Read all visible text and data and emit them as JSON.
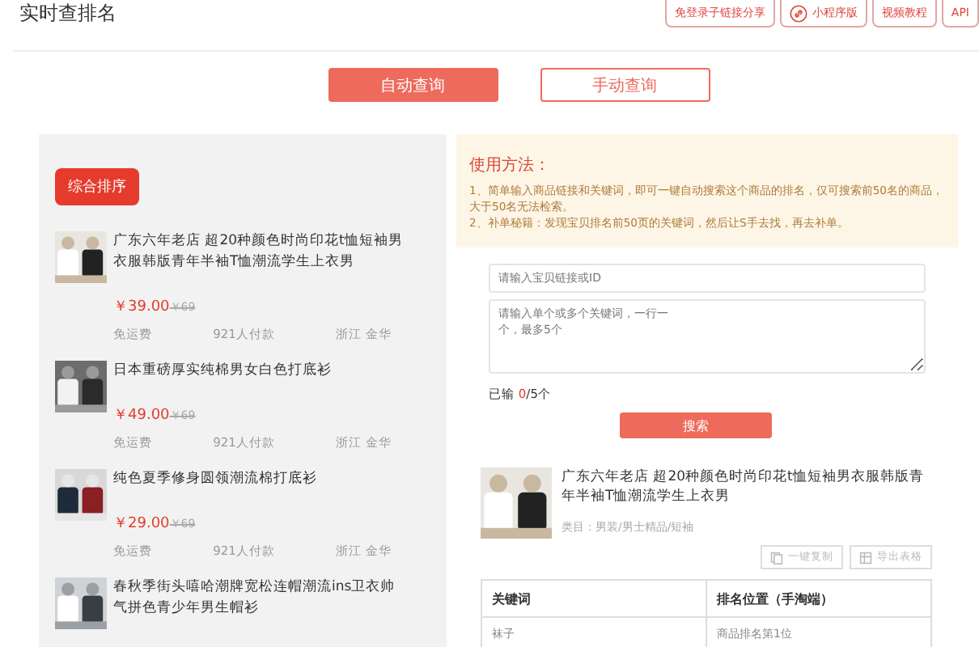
{
  "page_title": "实时查排名",
  "top_links": [
    {
      "label": "免登录子链接分享",
      "icon": false
    },
    {
      "label": "小程序版",
      "icon": true
    },
    {
      "label": "视频教程",
      "icon": false
    },
    {
      "label": "API",
      "icon": false
    }
  ],
  "tabs": [
    {
      "label": "自动查询",
      "selected": true
    },
    {
      "label": "手动查询",
      "selected": false
    }
  ],
  "sort_button": "综合排序",
  "products": [
    {
      "kind": "picture",
      "title": "广东六年老店 超20种颜色时尚印花t恤短袖男衣服韩版青年半袖T恤潮流学生上衣男",
      "price": "￥39.00",
      "old_price": "￥69",
      "shipping": "免运费",
      "sales": "921人付款",
      "location": "浙江 金华"
    },
    {
      "kind": "picture",
      "title": "日本重磅厚实纯棉男女白色打底衫",
      "price": "￥49.00",
      "old_price": "￥69",
      "shipping": "免运费",
      "sales": "921人付款",
      "location": "浙江 金华"
    },
    {
      "kind": "picture",
      "title": "纯色夏季修身圆领潮流棉打底衫",
      "price": "￥29.00",
      "old_price": "￥69",
      "shipping": "免运费",
      "sales": "921人付款",
      "location": "浙江 金华"
    },
    {
      "kind": "picture",
      "title": "春秋季街头嘻哈潮牌宽松连帽潮流ins卫衣帅气拼色青少年男生帽衫"
    }
  ],
  "notice": {
    "title": "使用方法：",
    "lines": [
      "1、简单输入商品链接和关键词，即可一键自动搜索这个商品的排名，仅可搜索前50名的商品，大于50名无法检索。",
      "2、补单秘籍：发现宝贝排名前50页的关键词，然后让S手去找，再去补单。"
    ]
  },
  "link_input": {
    "placeholder": "请输入宝贝链接或ID"
  },
  "keyword_input": {
    "placeholder": "请输入单个或多个关键词，一行一个，最多5个"
  },
  "counter": {
    "label": "已输",
    "count": "0",
    "limit": "/5个"
  },
  "search_button": "搜索",
  "result": {
    "title": "广东六年老店 超20种颜色时尚印花t恤短袖男衣服韩版青年半袖T恤潮流学生上衣男",
    "category": "类目：男装/男士精品/短袖"
  },
  "actions": [
    "一键复制",
    "导出表格"
  ],
  "table": {
    "columns": [
      "关键词",
      "排名位置（手淘端）"
    ],
    "rows": [
      [
        "袜子",
        "商品排名第1位"
      ]
    ]
  }
}
